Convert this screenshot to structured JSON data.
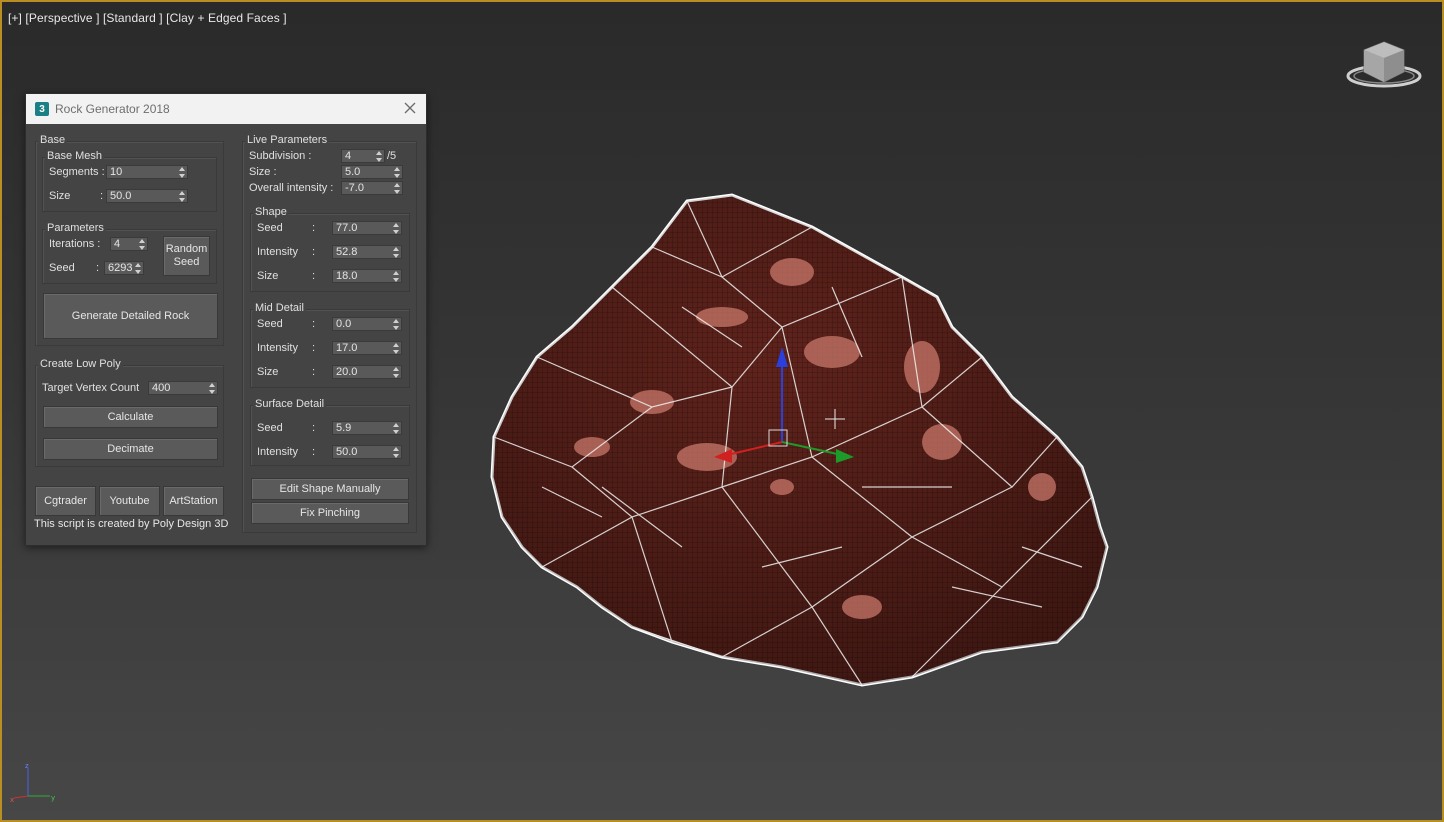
{
  "viewport": {
    "label": "[+] [Perspective ] [Standard ] [Clay + Edged Faces ]",
    "accent_border": "#b98f23",
    "rock_color": "#6b2a22"
  },
  "dialog": {
    "title": "Rock Generator 2018",
    "app_icon": "3",
    "base": {
      "title": "Base",
      "base_mesh": {
        "title": "Base Mesh",
        "segments_label": "Segments :",
        "segments_value": "10",
        "size_label": "Size",
        "size_colon": ":",
        "size_value": "50.0"
      },
      "parameters": {
        "title": "Parameters",
        "iterations_label": "Iterations :",
        "iterations_value": "4",
        "seed_label": "Seed",
        "seed_colon": ":",
        "seed_value": "6293",
        "random_seed_line1": "Random",
        "random_seed_line2": "Seed"
      },
      "generate_label": "Generate Detailed Rock"
    },
    "low_poly": {
      "title": "Create Low Poly",
      "target_label": "Target Vertex Count",
      "target_value": "400",
      "calculate_label": "Calculate",
      "decimate_label": "Decimate"
    },
    "links": {
      "cgtrader": "Cgtrader",
      "youtube": "Youtube",
      "artstation": "ArtStation"
    },
    "credit": "This script is created by Poly Design 3D",
    "live": {
      "title": "Live Parameters",
      "subdivision_label": "Subdivision :",
      "subdivision_value": "4",
      "subdivision_max": "/5",
      "size_label": "Size :",
      "size_value": "5.0",
      "overall_label": "Overall intensity :",
      "overall_value": "-7.0",
      "shape": {
        "title": "Shape",
        "seed_label": "Seed",
        "seed_value": "77.0",
        "intensity_label": "Intensity",
        "intensity_value": "52.8",
        "size_label": "Size",
        "size_value": "18.0"
      },
      "mid": {
        "title": "Mid Detail",
        "seed_label": "Seed",
        "seed_value": "0.0",
        "intensity_label": "Intensity",
        "intensity_value": "17.0",
        "size_label": "Size",
        "size_value": "20.0"
      },
      "surface": {
        "title": "Surface Detail",
        "seed_label": "Seed",
        "seed_value": "5.9",
        "intensity_label": "Intensity",
        "intensity_value": "50.0"
      },
      "colon": ":",
      "edit_label": "Edit Shape Manually",
      "pinch_label": "Fix Pinching"
    }
  }
}
